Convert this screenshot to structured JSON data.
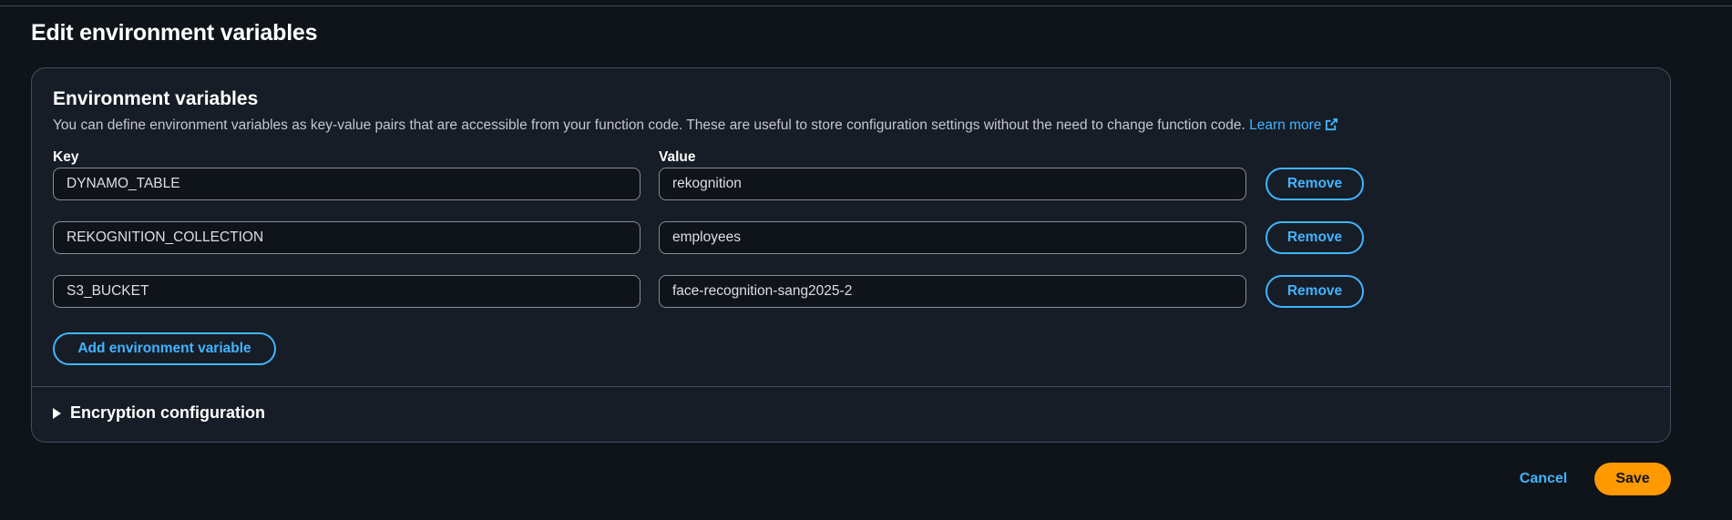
{
  "page": {
    "title": "Edit environment variables"
  },
  "panel": {
    "title": "Environment variables",
    "description": "You can define environment variables as key-value pairs that are accessible from your function code. These are useful to store configuration settings without the need to change function code.",
    "learn_more": "Learn more",
    "learn_more_icon": "external-link-icon",
    "key_label": "Key",
    "value_label": "Value",
    "variables": [
      {
        "key": "DYNAMO_TABLE",
        "value": "rekognition",
        "remove_label": "Remove"
      },
      {
        "key": "REKOGNITION_COLLECTION",
        "value": "employees",
        "remove_label": "Remove"
      },
      {
        "key": "S3_BUCKET",
        "value": "face-recognition-sang2025-2",
        "remove_label": "Remove"
      }
    ],
    "add_label": "Add environment variable",
    "encryption": {
      "label": "Encryption configuration",
      "icon": "caret-right-icon",
      "expanded": false
    }
  },
  "footer": {
    "cancel_label": "Cancel",
    "save_label": "Save"
  },
  "colors": {
    "background": "#0f141a",
    "panel": "#161d26",
    "border": "#414d5c",
    "link": "#42b4ff",
    "primary": "#ff9900"
  }
}
